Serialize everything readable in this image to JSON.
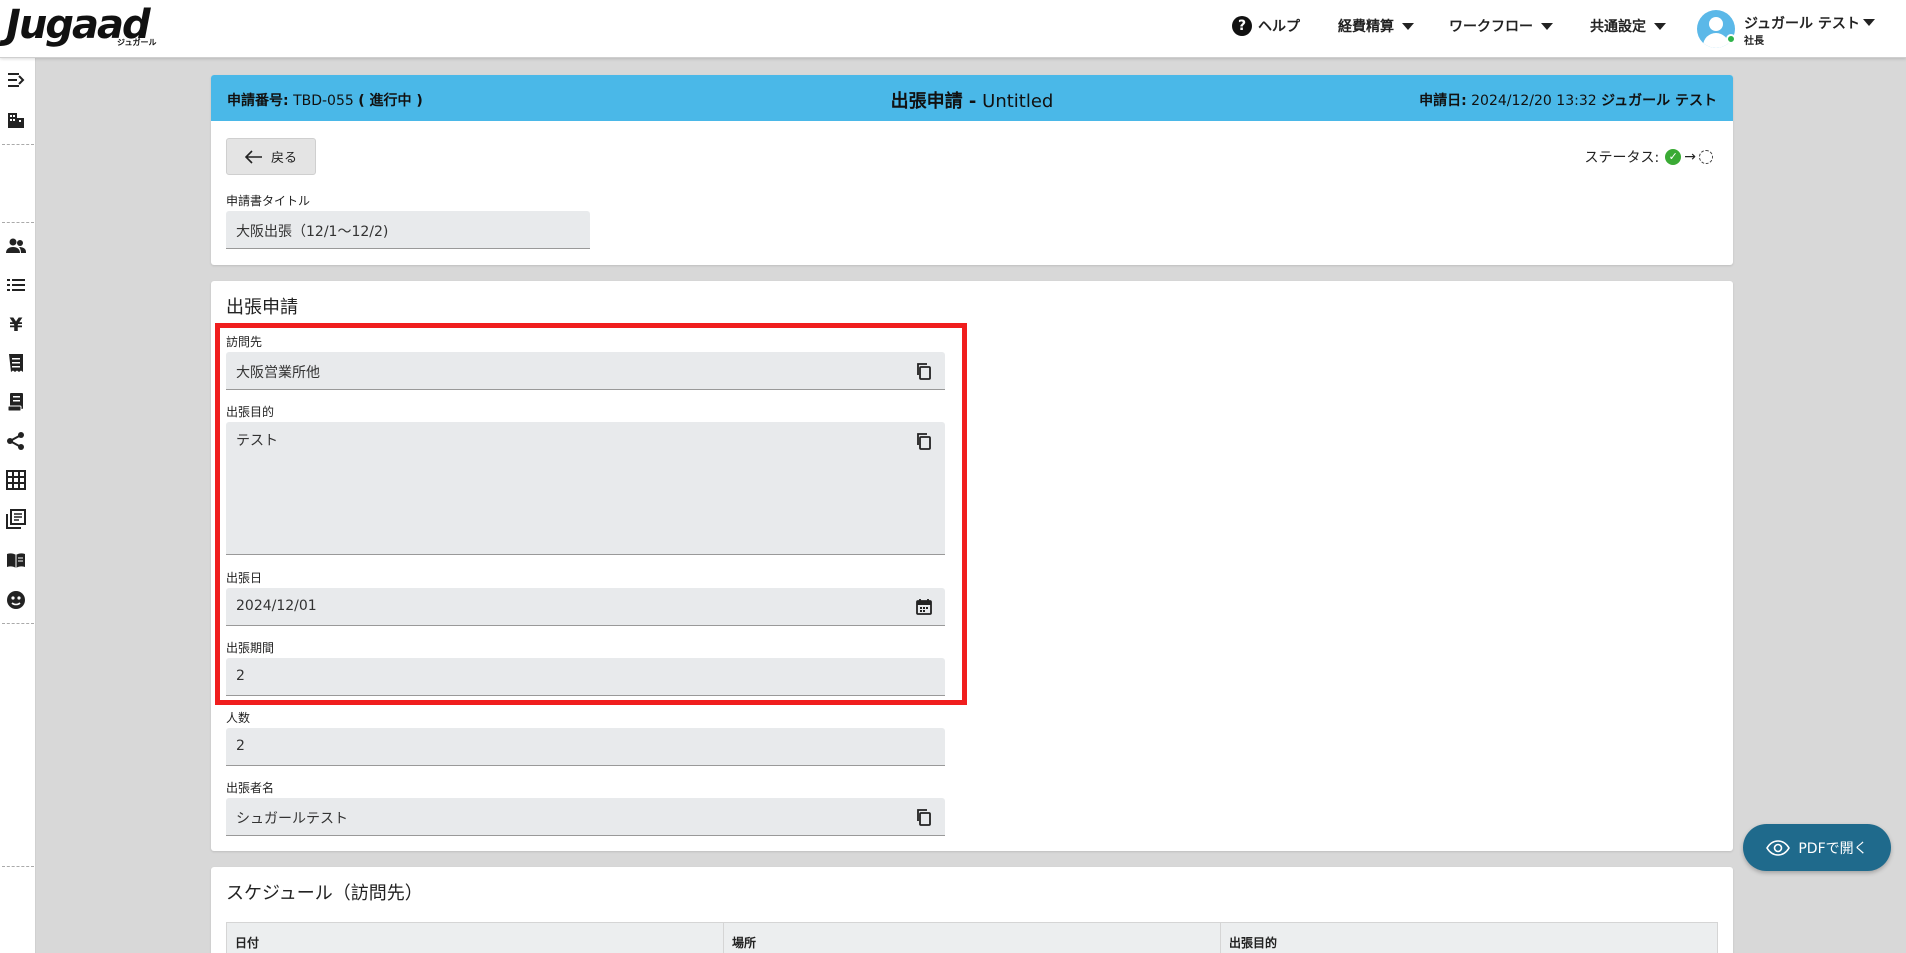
{
  "app": {
    "logo": "Jugaad",
    "logo_sub": "ジュガール"
  },
  "topnav": {
    "help": "ヘルプ",
    "expense": "経費精算",
    "workflow": "ワークフロー",
    "common_settings": "共通設定"
  },
  "user": {
    "name": "ジュガール テスト",
    "role": "社長"
  },
  "request": {
    "number_label": "申請番号:",
    "number": "TBD-055",
    "status_text": "( 進行中 )",
    "title_bold": "出張申請 -",
    "title_rest": "Untitled",
    "date_label": "申請日:",
    "date": "2024/12/20 13:32",
    "applicant": "ジュガール テスト",
    "back_label": "戻る",
    "status_label": "ステータス:",
    "doc_title_label": "申請書タイトル",
    "doc_title_value": "大阪出張（12/1〜12/2)"
  },
  "trip": {
    "section_title": "出張申請",
    "destination_label": "訪問先",
    "destination_value": "大阪営業所他",
    "purpose_label": "出張目的",
    "purpose_value": "テスト",
    "date_label": "出張日",
    "date_value": "2024/12/01",
    "period_label": "出張期間",
    "period_value": "2",
    "people_label": "人数",
    "people_value": "2",
    "traveler_label": "出張者名",
    "traveler_value": "シュガールテスト"
  },
  "schedule": {
    "section_title": "スケジュール（訪問先）",
    "columns": [
      "日付",
      "場所",
      "出張目的"
    ]
  },
  "pdf_button": "PDFで開く",
  "colors": {
    "header_blue": "#4ab8e8",
    "highlight_red": "#f01e1e",
    "pdf_button": "#1f6a8c"
  }
}
